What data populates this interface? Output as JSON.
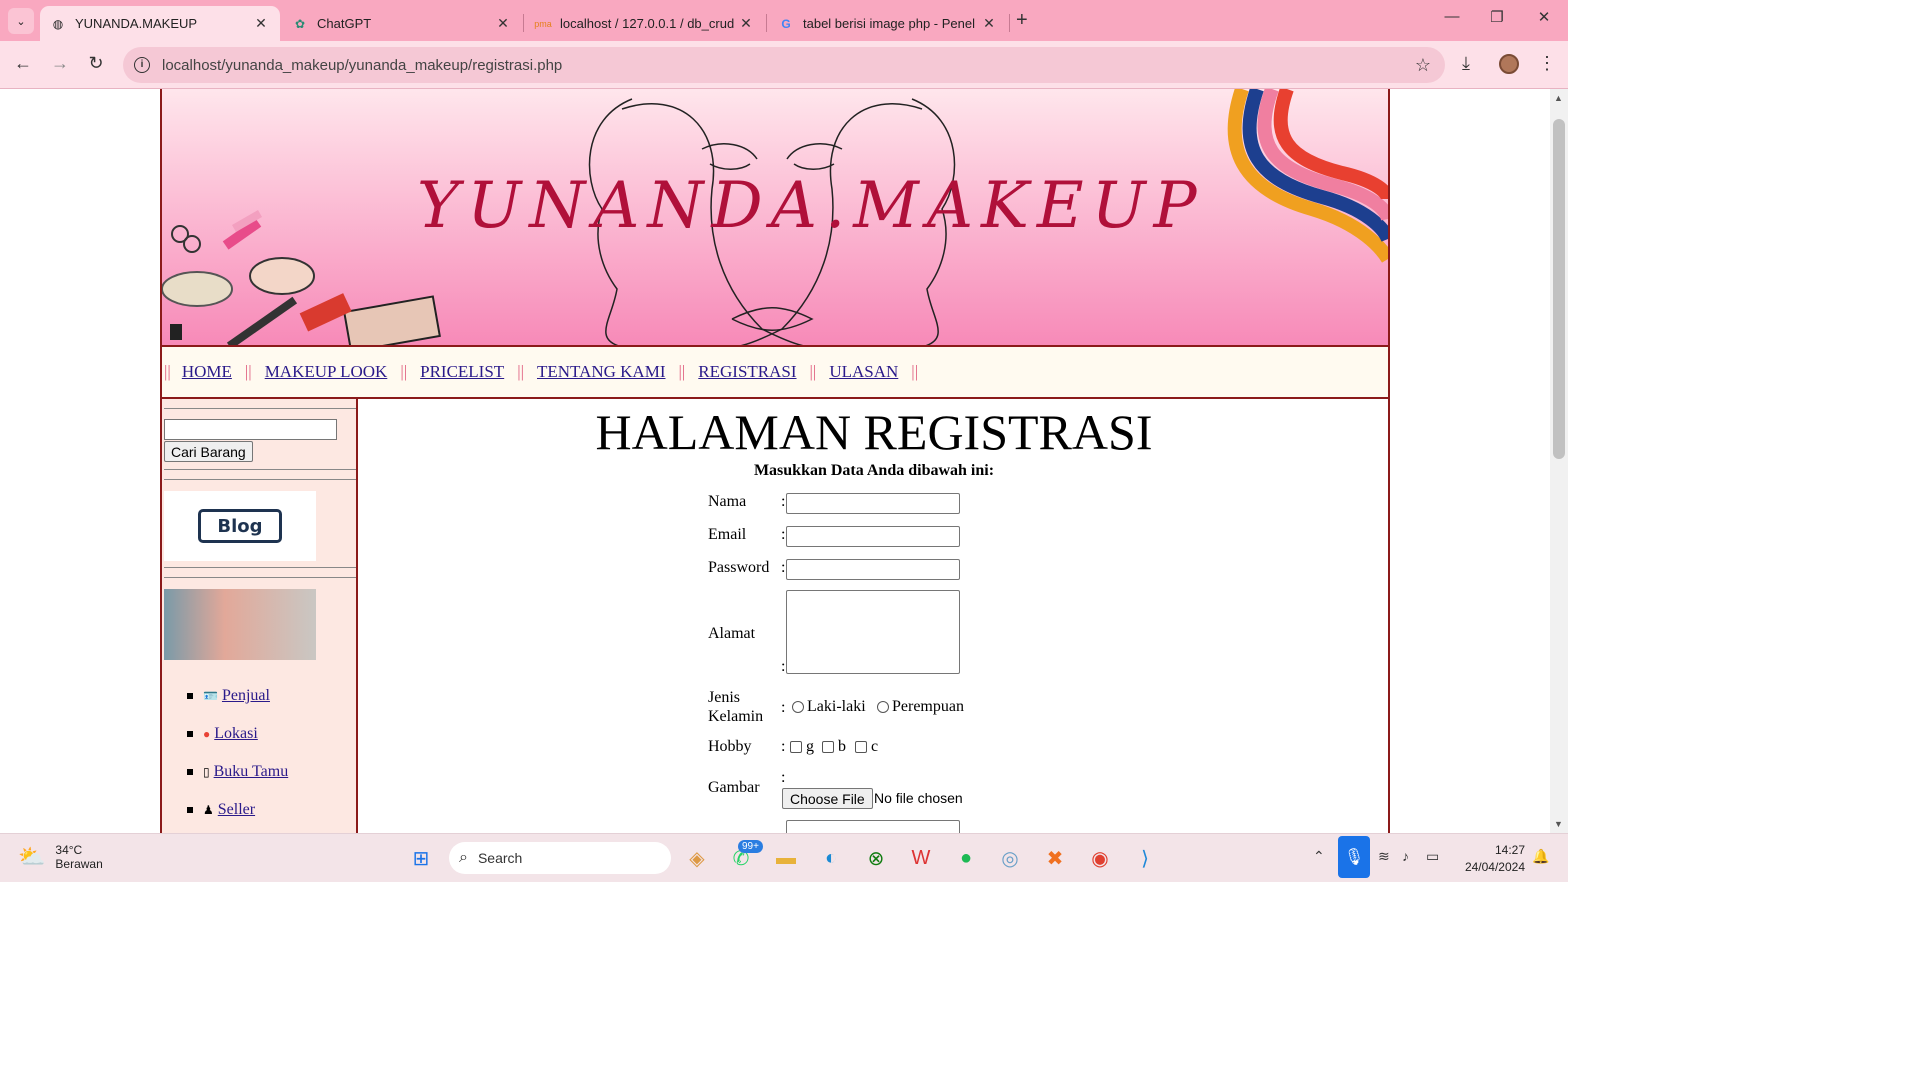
{
  "browser": {
    "tabs": [
      {
        "title": "YUNANDA.MAKEUP",
        "icon": "globe-icon",
        "active": true
      },
      {
        "title": "ChatGPT",
        "icon": "chatgpt-icon",
        "active": false
      },
      {
        "title": "localhost / 127.0.0.1 / db_crud /",
        "icon": "phpmyadmin-icon",
        "active": false
      },
      {
        "title": "tabel berisi image php - Penel",
        "icon": "google-icon",
        "active": false
      }
    ],
    "url": "localhost/yunanda_makeup/yunanda_makeup/registrasi.php"
  },
  "site": {
    "banner_title": "YUNANDA.MAKEUP",
    "menu": [
      "HOME",
      "MAKEUP LOOK",
      "PRICELIST",
      "TENTANG KAMI",
      "REGISTRASI",
      "ULASAN"
    ],
    "search_button": "Cari Barang",
    "blog_label": "Blog",
    "links": [
      {
        "label": "Penjual",
        "icon": "id-card-icon"
      },
      {
        "label": "Lokasi",
        "icon": "map-pin-icon"
      },
      {
        "label": "Buku Tamu",
        "icon": "guestbook-icon"
      },
      {
        "label": "Seller",
        "icon": "person-icon"
      }
    ]
  },
  "form": {
    "heading": "HALAMAN REGISTRASI",
    "subheading": "Masukkan Data Anda dibawah ini:",
    "labels": {
      "nama": "Nama",
      "email": "Email",
      "password": "Password",
      "alamat": "Alamat",
      "jenis_kelamin": "Jenis Kelamin",
      "hobby": "Hobby",
      "gambar": "Gambar"
    },
    "colon": ":",
    "gender_options": [
      "Laki-laki",
      "Perempuan"
    ],
    "hobby_options": [
      "g",
      "b",
      "c"
    ],
    "file_button": "Choose File",
    "file_status": "No file chosen"
  },
  "taskbar": {
    "temperature": "34°C",
    "weather": "Berawan",
    "search_placeholder": "Search",
    "whatsapp_badge": "99+",
    "time": "14:27",
    "date": "24/04/2024"
  }
}
